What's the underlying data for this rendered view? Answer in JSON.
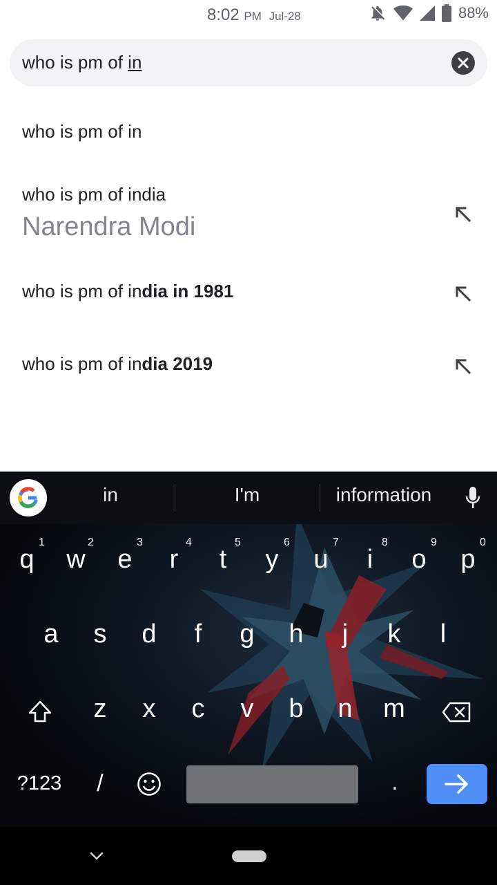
{
  "status_bar": {
    "time": "8:02",
    "ampm": "PM",
    "date": "Jul-28",
    "battery": "88%"
  },
  "search": {
    "query_prefix": "who is pm of ",
    "query_cursor_word": "in"
  },
  "suggestions": [
    {
      "plain": "who is pm of in",
      "bold": ""
    },
    {
      "plain": "who is pm of india",
      "bold": "",
      "answer": "Narendra Modi"
    },
    {
      "plain": "who is pm of in",
      "bold": "dia in 1981"
    },
    {
      "plain": "who is pm of in",
      "bold": "dia 2019"
    }
  ],
  "keyboard": {
    "suggestions": [
      "in",
      "I'm",
      "information"
    ],
    "row1": [
      "q",
      "w",
      "e",
      "r",
      "t",
      "y",
      "u",
      "i",
      "o",
      "p"
    ],
    "row1_nums": [
      "1",
      "2",
      "3",
      "4",
      "5",
      "6",
      "7",
      "8",
      "9",
      "0"
    ],
    "row2": [
      "a",
      "s",
      "d",
      "f",
      "g",
      "h",
      "j",
      "k",
      "l"
    ],
    "row3": [
      "z",
      "x",
      "c",
      "v",
      "b",
      "n",
      "m"
    ],
    "symbols_key": "?123",
    "slash_key": "/",
    "period_key": "."
  },
  "icons": {
    "dnd": "notifications-off-icon",
    "wifi": "wifi-icon",
    "signal": "cell-signal-icon",
    "battery": "battery-icon",
    "clear": "close-icon",
    "fill": "arrow-up-left-icon",
    "google": "google-g-icon",
    "mic": "mic-icon",
    "shift": "shift-icon",
    "backspace": "backspace-icon",
    "emoji": "emoji-icon",
    "enter": "arrow-right-icon",
    "nav_back": "chevron-down-icon"
  },
  "colors": {
    "accent": "#4f8ef7",
    "search_bg": "#f1f3f4",
    "answer_gray": "#80868b"
  }
}
